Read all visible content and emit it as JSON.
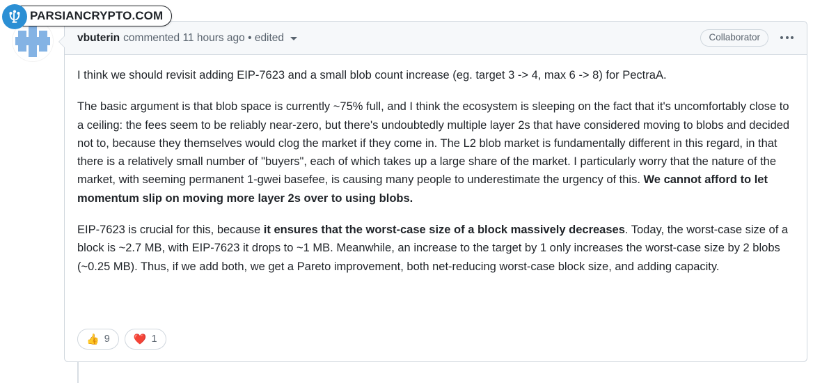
{
  "watermark": {
    "text": "PARSIANCRYPTO.COM",
    "logo_icon": "parsiancrypto-logo-icon",
    "brand_color": "#2b8fd4"
  },
  "comment": {
    "avatar_icon": "user-avatar-identicon",
    "header": {
      "author": "vbuterin",
      "meta": "commented 11 hours ago • edited",
      "edited_caret_icon": "chevron-down-icon",
      "collaborator_badge": "Collaborator",
      "kebab_icon": "kebab-horizontal-icon"
    },
    "body": {
      "paragraph_1": "I think we should revisit adding EIP-7623 and a small blob count increase (eg. target 3 -> 4, max 6 -> 8) for PectraA.",
      "paragraph_2_part_1": "The basic argument is that blob space is currently ~75% full, and I think the ecosystem is sleeping on the fact that it's uncomfortably close to a ceiling: the fees seem to be reliably near-zero, but there's undoubtedly multiple layer 2s that have considered moving to blobs and decided not to, because they themselves would clog the market if they come in. The L2 blob market is fundamentally different in this regard, in that there is a relatively small number of \"buyers\", each of which takes up a large share of the market. I particularly worry that the nature of the market, with seeming permanent 1-gwei basefee, is causing many people to underestimate the urgency of this. ",
      "paragraph_2_bold": "We cannot afford to let momentum slip on moving more layer 2s over to using blobs.",
      "paragraph_3_part_1": "EIP-7623 is crucial for this, because ",
      "paragraph_3_bold": "it ensures that the worst-case size of a block massively decreases",
      "paragraph_3_part_2": ". Today, the worst-case size of a block is ~2.7 MB, with EIP-7623 it drops to ~1 MB. Meanwhile, an increase to the target by 1 only increases the worst-case size by 2 blobs (~0.25 MB). Thus, if we add both, we get a Pareto improvement, both net-reducing worst-case block size, and adding capacity."
    },
    "reactions": [
      {
        "emoji": "👍",
        "icon_name": "thumbs-up-emoji",
        "count": "9"
      },
      {
        "emoji": "❤️",
        "icon_name": "heart-emoji",
        "count": "1"
      }
    ]
  }
}
